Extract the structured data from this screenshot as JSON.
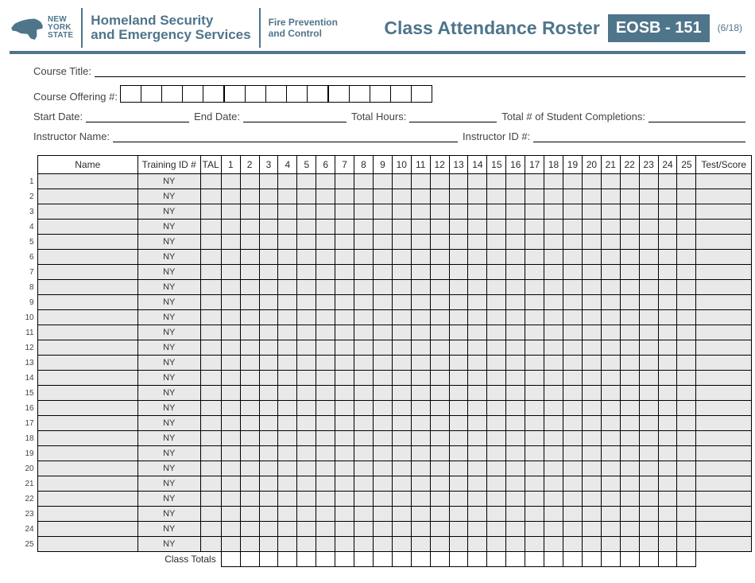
{
  "header": {
    "nys_line1": "NEW",
    "nys_line2": "YORK",
    "nys_line3": "STATE",
    "agency_line1": "Homeland Security",
    "agency_line2": "and Emergency Services",
    "division_line1": "Fire Prevention",
    "division_line2": "and Control",
    "title": "Class Attendance Roster",
    "form_id": "EOSB - 151",
    "revision": "(6/18)"
  },
  "fields": {
    "course_title_label": "Course Title:",
    "course_offering_label": "Course Offering #:",
    "start_date_label": "Start Date:",
    "end_date_label": "End Date:",
    "total_hours_label": "Total Hours:",
    "total_completions_label": "Total # of Student Completions:",
    "instructor_name_label": "Instructor Name:",
    "instructor_id_label": "Instructor ID #:",
    "course_title_value": "",
    "start_date_value": "",
    "end_date_value": "",
    "total_hours_value": "",
    "total_completions_value": "",
    "instructor_name_value": "",
    "instructor_id_value": "",
    "offering_boxes_count": 15,
    "offering_group_size": 5
  },
  "table": {
    "headers": {
      "name": "Name",
      "training_id": "Training ID #",
      "tal": "TAL",
      "sessions": [
        "1",
        "2",
        "3",
        "4",
        "5",
        "6",
        "7",
        "8",
        "9",
        "10",
        "11",
        "12",
        "13",
        "14",
        "15",
        "16",
        "17",
        "18",
        "19",
        "20",
        "21",
        "22",
        "23",
        "24",
        "25"
      ],
      "test_score": "Test/Score"
    },
    "row_count": 25,
    "training_id_prefix": "NY",
    "class_totals_label": "Class Totals"
  }
}
